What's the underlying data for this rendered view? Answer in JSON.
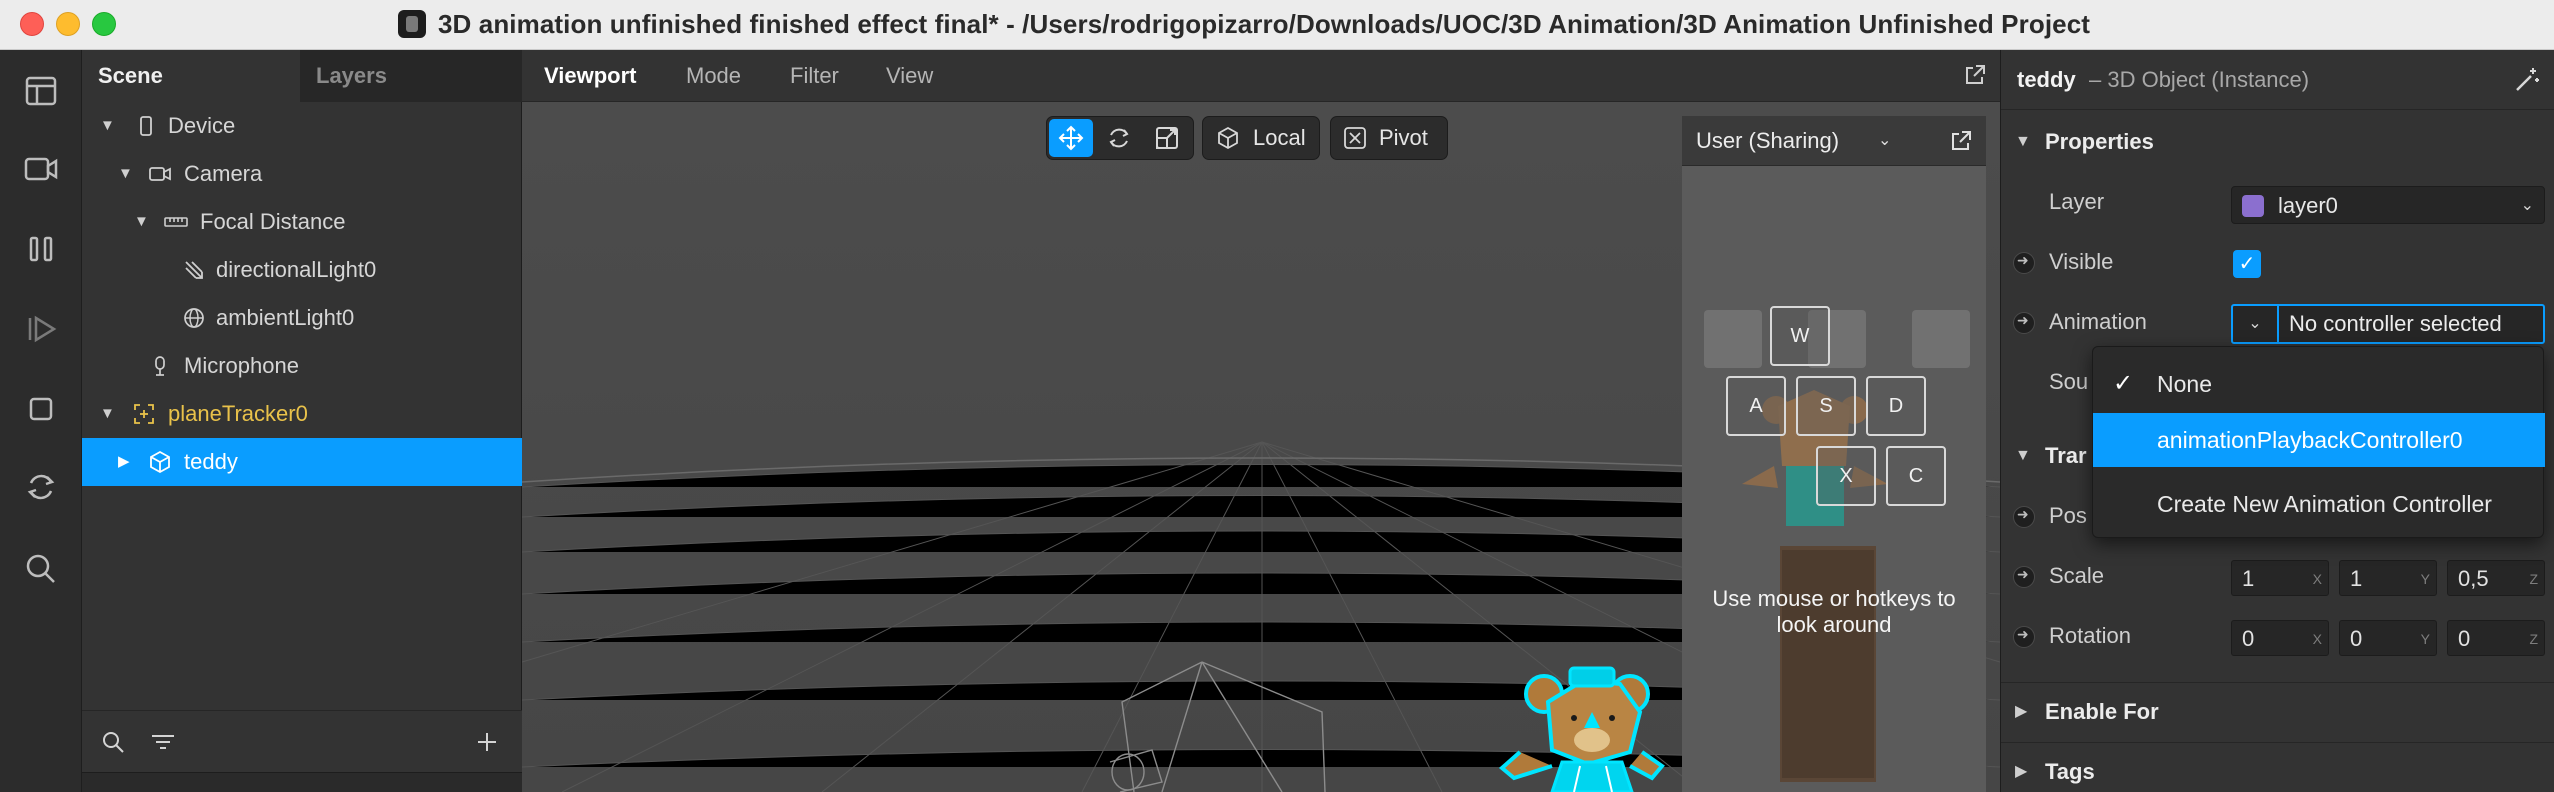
{
  "window": {
    "title": "3D animation unfinished finished effect final* - /Users/rodrigopizarro/Downloads/UOC/3D Animation/3D Animation Unfinished Project"
  },
  "sidebar_icons": [
    "layout-icon",
    "video-camera-icon",
    "pause-icon",
    "play-step-icon",
    "stop-square-icon",
    "refresh-icon",
    "search-icon"
  ],
  "scene_panel": {
    "tabs": [
      "Scene",
      "Layers"
    ],
    "tree": [
      {
        "label": "Device",
        "depth": 0,
        "icon": "phone-icon",
        "expanded": true
      },
      {
        "label": "Camera",
        "depth": 1,
        "icon": "camera-icon",
        "expanded": true
      },
      {
        "label": "Focal Distance",
        "depth": 2,
        "icon": "ruler-icon",
        "expanded": true
      },
      {
        "label": "directionalLight0",
        "depth": 3,
        "icon": "directional-light-icon"
      },
      {
        "label": "ambientLight0",
        "depth": 3,
        "icon": "globe-icon"
      },
      {
        "label": "Microphone",
        "depth": 2,
        "icon": "microphone-icon"
      },
      {
        "label": "planeTracker0",
        "depth": 0,
        "icon": "plane-tracker-icon",
        "expanded": true
      },
      {
        "label": "teddy",
        "depth": 1,
        "icon": "cube-icon",
        "expanded": false,
        "selected": true
      }
    ]
  },
  "viewport": {
    "tabs": [
      "Viewport",
      "Mode",
      "Filter",
      "View"
    ],
    "local_label": "Local",
    "pivot_label": "Pivot",
    "sim_dropdown": "User (Sharing)",
    "keys": [
      "W",
      "A",
      "S",
      "D",
      "X",
      "C"
    ],
    "hint": "Use mouse or hotkeys to look around"
  },
  "properties": {
    "object_name": "teddy",
    "object_type": "– 3D Object (Instance)",
    "section_properties": "Properties",
    "layer_label": "Layer",
    "layer_value": "layer0",
    "visible_label": "Visible",
    "visible_checked": "✓",
    "animation_label": "Animation",
    "animation_value": "No controller selected",
    "sound_label_partial": "Sou",
    "transform_partial": "Trar",
    "position_partial": "Pos",
    "scale_label": "Scale",
    "scale_values": [
      "1",
      "1",
      "0,5"
    ],
    "rotation_label": "Rotation",
    "rotation_values": [
      "0",
      "0",
      "0"
    ],
    "axes": [
      "X",
      "Y",
      "Z"
    ],
    "enable_for": "Enable For",
    "tags": "Tags"
  },
  "animation_menu": {
    "items": [
      "None",
      "animationPlaybackController0",
      "Create New Animation Controller"
    ],
    "checked_index": 0,
    "highlighted_index": 1
  },
  "colors": {
    "accent": "#0a9dff",
    "tracker": "#e9c24a",
    "teddy_highlight": "#00e5ff",
    "layer_swatch": "#8b6fcf"
  }
}
